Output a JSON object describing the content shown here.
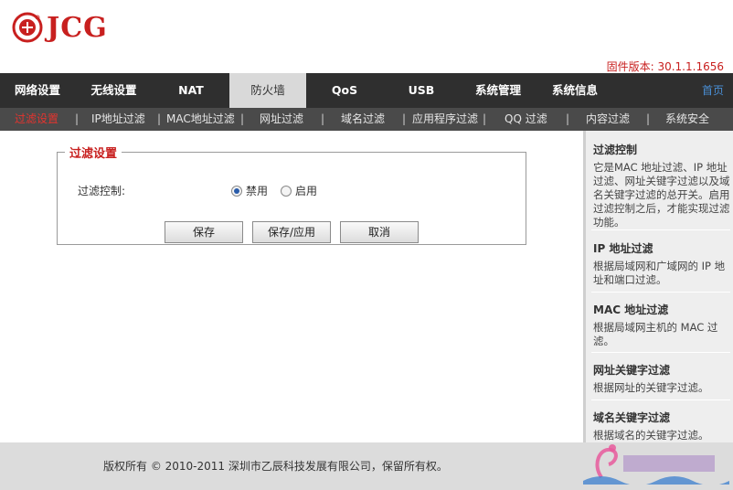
{
  "brand": {
    "name": "JCG"
  },
  "firmware": "固件版本: 30.1.1.1656",
  "mainnav": {
    "items": [
      "网络设置",
      "无线设置",
      "NAT",
      "防火墙",
      "QoS",
      "USB",
      "系统管理",
      "系统信息"
    ],
    "active_index": 3,
    "home": "首页"
  },
  "subnav": {
    "items": [
      "过滤设置",
      "IP地址过滤",
      "MAC地址过滤",
      "网址过滤",
      "域名过滤",
      "应用程序过滤",
      "QQ 过滤",
      "内容过滤",
      "系统安全"
    ],
    "active_index": 0
  },
  "form": {
    "legend": "过滤设置",
    "label": "过滤控制:",
    "options": [
      {
        "label": "禁用",
        "checked": true
      },
      {
        "label": "启用",
        "checked": false
      }
    ],
    "buttons": {
      "save": "保存",
      "save_apply": "保存/应用",
      "cancel": "取消"
    }
  },
  "help": [
    {
      "title": "过滤控制",
      "text": "它是MAC 地址过滤、IP 地址过滤、网址关键字过滤以及域名关键字过滤的总开关。启用过滤控制之后，才能实现过滤功能。"
    },
    {
      "title": "IP 地址过滤",
      "text": "根据局域网和广域网的 IP 地址和端口过滤。"
    },
    {
      "title": "MAC 地址过滤",
      "text": "根据局域网主机的 MAC 过滤。"
    },
    {
      "title": "网址关键字过滤",
      "text": "根据网址的关键字过滤。"
    },
    {
      "title": "域名关键字过滤",
      "text": "根据域名的关键字过滤。"
    }
  ],
  "footer": {
    "copyright": "版权所有 © 2010-2011 深圳市乙辰科技发展有限公司，保留所有权。"
  },
  "colors": {
    "brand_red": "#c8201f",
    "nav_dark": "#2f2f2f",
    "subnav": "#4a4a4a",
    "active_sub": "#e3342f",
    "home_link": "#4a8fd6"
  }
}
